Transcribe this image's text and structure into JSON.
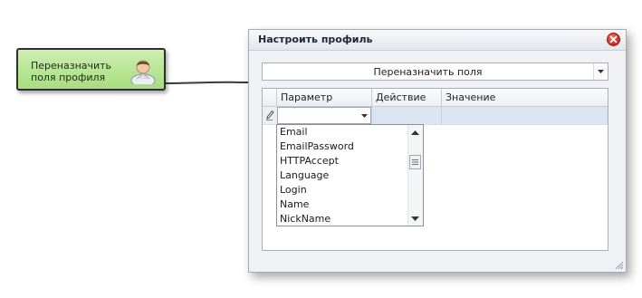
{
  "node": {
    "label": "Переназначить\nполя профиля",
    "icon": "user-avatar-icon",
    "fill_color": "#b5e392"
  },
  "dialog": {
    "title": "Настроить профиль",
    "mode_select": {
      "value": "Переназначить поля"
    },
    "grid": {
      "columns": [
        "Параметр",
        "Действие",
        "Значение"
      ],
      "new_row": {
        "parameter": "",
        "action": "",
        "value": ""
      }
    },
    "parameter_options": [
      "Email",
      "EmailPassword",
      "HTTPAccept",
      "Language",
      "Login",
      "Name",
      "NickName"
    ]
  },
  "colors": {
    "close_button": "#d63a2e",
    "selected_row": "#dbe4f3"
  }
}
